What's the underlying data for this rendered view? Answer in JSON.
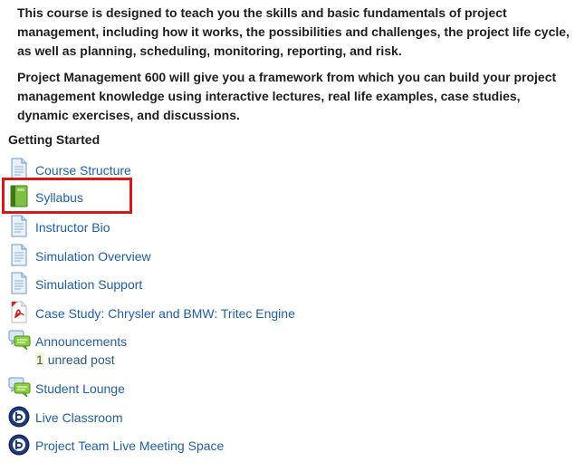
{
  "intro": {
    "paragraph1": "This course is designed to teach you the skills and basic fundamentals of project management, including how it works, the possibilities and challenges, the project life cycle, as well as planning, scheduling, monitoring, reporting, and risk.",
    "paragraph2": "Project Management 600 will give you a framework from which you can build your project management knowledge using interactive lectures, real life examples, case studies, dynamic exercises, and discussions."
  },
  "section_title": "Getting Started",
  "items": [
    {
      "label": "Course Structure",
      "icon": "document-icon"
    },
    {
      "label": "Syllabus",
      "icon": "book-icon"
    },
    {
      "label": "Instructor Bio",
      "icon": "document-icon"
    },
    {
      "label": "Simulation Overview",
      "icon": "document-icon"
    },
    {
      "label": "Simulation Support",
      "icon": "document-icon"
    },
    {
      "label": "Case Study: Chrysler and BMW: Tritec Engine",
      "icon": "pdf-icon"
    },
    {
      "label": "Announcements",
      "icon": "forum-icon",
      "unread_count": "1",
      "unread_suffix": "unread post"
    },
    {
      "label": "Student Lounge",
      "icon": "forum-icon"
    },
    {
      "label": "Live Classroom",
      "icon": "live-session-icon"
    },
    {
      "label": "Project Team Live Meeting Space",
      "icon": "live-session-icon"
    }
  ],
  "colors": {
    "link": "#1f5fa8",
    "highlight": "#d21a1a",
    "unread_bg": "#f7f4cf"
  }
}
